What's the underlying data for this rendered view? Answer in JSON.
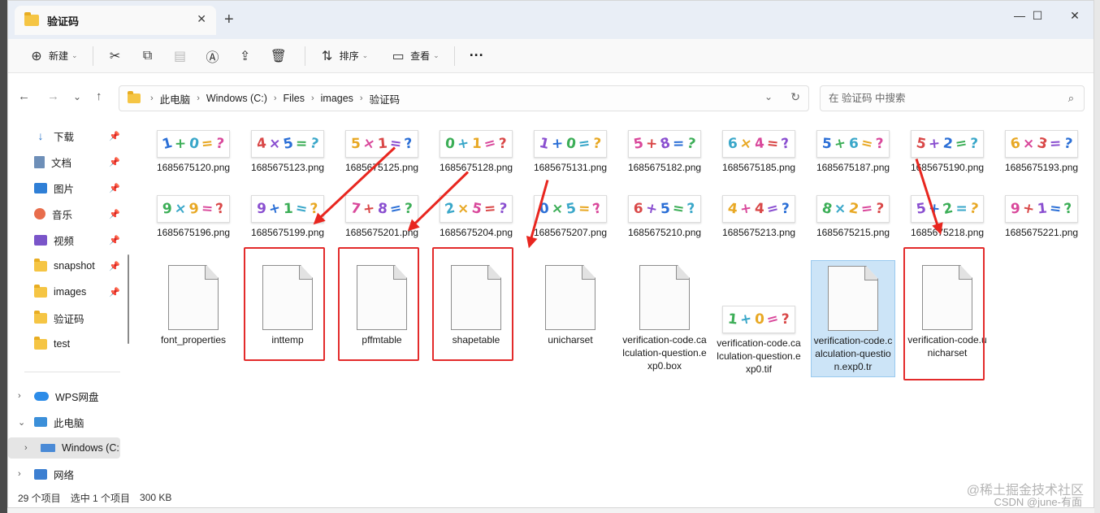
{
  "window": {
    "tab_title": "验证码",
    "tab_close": "✕",
    "new_tab": "+",
    "minimize": "—",
    "maximize": "☐",
    "close": "✕"
  },
  "toolbar": {
    "new_label": "新建",
    "sort_label": "排序",
    "view_label": "查看",
    "more_label": "···"
  },
  "address": {
    "crumbs": [
      "此电脑",
      "Windows (C:)",
      "Files",
      "images",
      "验证码"
    ],
    "search_placeholder": "在 验证码 中搜索"
  },
  "sidebar": {
    "pinned": [
      {
        "label": "下载",
        "icon": "download-icon"
      },
      {
        "label": "文档",
        "icon": "document-icon"
      },
      {
        "label": "图片",
        "icon": "picture-icon"
      },
      {
        "label": "音乐",
        "icon": "music-icon"
      },
      {
        "label": "视频",
        "icon": "video-icon"
      },
      {
        "label": "snapshot",
        "icon": "folder-icon"
      },
      {
        "label": "images",
        "icon": "folder-icon"
      },
      {
        "label": "验证码",
        "icon": "folder-icon"
      },
      {
        "label": "test",
        "icon": "folder-icon"
      }
    ],
    "wps": "WPS网盘",
    "this_pc": "此电脑",
    "drive": "Windows (C:",
    "network": "网络"
  },
  "files": {
    "row1": [
      {
        "name": "1685675120.png",
        "glyphs": [
          "1",
          "+",
          "0",
          "=",
          "?"
        ]
      },
      {
        "name": "1685675123.png",
        "glyphs": [
          "4",
          "×",
          "5",
          "=",
          "?"
        ]
      },
      {
        "name": "1685675125.png",
        "glyphs": [
          "5",
          "×",
          "1",
          "=",
          "?"
        ]
      },
      {
        "name": "1685675128.png",
        "glyphs": [
          "0",
          "+",
          "1",
          "=",
          "?"
        ]
      },
      {
        "name": "1685675131.png",
        "glyphs": [
          "1",
          "+",
          "0",
          "=",
          "?"
        ]
      },
      {
        "name": "1685675182.png",
        "glyphs": [
          "5",
          "+",
          "8",
          "=",
          "?"
        ]
      },
      {
        "name": "1685675185.png",
        "glyphs": [
          "6",
          "×",
          "4",
          "=",
          "?"
        ]
      },
      {
        "name": "1685675187.png",
        "glyphs": [
          "5",
          "+",
          "6",
          "=",
          "?"
        ]
      },
      {
        "name": "1685675190.png",
        "glyphs": [
          "5",
          "+",
          "2",
          "=",
          "?"
        ]
      },
      {
        "name": "1685675193.png",
        "glyphs": [
          "6",
          "×",
          "3",
          "=",
          "?"
        ]
      }
    ],
    "row2": [
      {
        "name": "1685675196.png",
        "glyphs": [
          "9",
          "×",
          "9",
          "=",
          "?"
        ]
      },
      {
        "name": "1685675199.png",
        "glyphs": [
          "9",
          "+",
          "1",
          "=",
          "?"
        ]
      },
      {
        "name": "1685675201.png",
        "glyphs": [
          "7",
          "+",
          "8",
          "=",
          "?"
        ]
      },
      {
        "name": "1685675204.png",
        "glyphs": [
          "2",
          "×",
          "5",
          "=",
          "?"
        ]
      },
      {
        "name": "1685675207.png",
        "glyphs": [
          "0",
          "×",
          "5",
          "=",
          "?"
        ]
      },
      {
        "name": "1685675210.png",
        "glyphs": [
          "6",
          "+",
          "5",
          "=",
          "?"
        ]
      },
      {
        "name": "1685675213.png",
        "glyphs": [
          "4",
          "+",
          "4",
          "=",
          "?"
        ]
      },
      {
        "name": "1685675215.png",
        "glyphs": [
          "8",
          "×",
          "2",
          "=",
          "?"
        ]
      },
      {
        "name": "1685675218.png",
        "glyphs": [
          "5",
          "+",
          "2",
          "=",
          "?"
        ]
      },
      {
        "name": "1685675221.png",
        "glyphs": [
          "9",
          "+",
          "1",
          "=",
          "?"
        ]
      }
    ],
    "row3": [
      {
        "name": "font_properties",
        "kind": "blank"
      },
      {
        "name": "inttemp",
        "kind": "blank",
        "highlighted": true
      },
      {
        "name": "pffmtable",
        "kind": "blank",
        "highlighted": true
      },
      {
        "name": "shapetable",
        "kind": "blank",
        "highlighted": true
      },
      {
        "name": "unicharset",
        "kind": "blank"
      },
      {
        "name": "verification-code.calculation-question.exp0.box",
        "kind": "blank"
      },
      {
        "name": "verification-code.calculation-question.exp0.tif",
        "kind": "image",
        "glyphs": [
          "1",
          "+",
          "0",
          "=",
          "?"
        ]
      },
      {
        "name": "verification-code.calculation-question.exp0.tr",
        "kind": "blank",
        "selected": true
      },
      {
        "name": "verification-code.unicharset",
        "kind": "blank",
        "highlighted": true
      }
    ]
  },
  "status": {
    "count": "29 个项目",
    "selection": "选中 1 个项目",
    "size": "300 KB"
  },
  "watermarks": {
    "juejin": "@稀土掘金技术社区",
    "csdn": "CSDN @june-有面"
  },
  "colors": {
    "highlight_box": "#e32b2b",
    "selection": "#cce4f7",
    "folder": "#f5c544"
  }
}
